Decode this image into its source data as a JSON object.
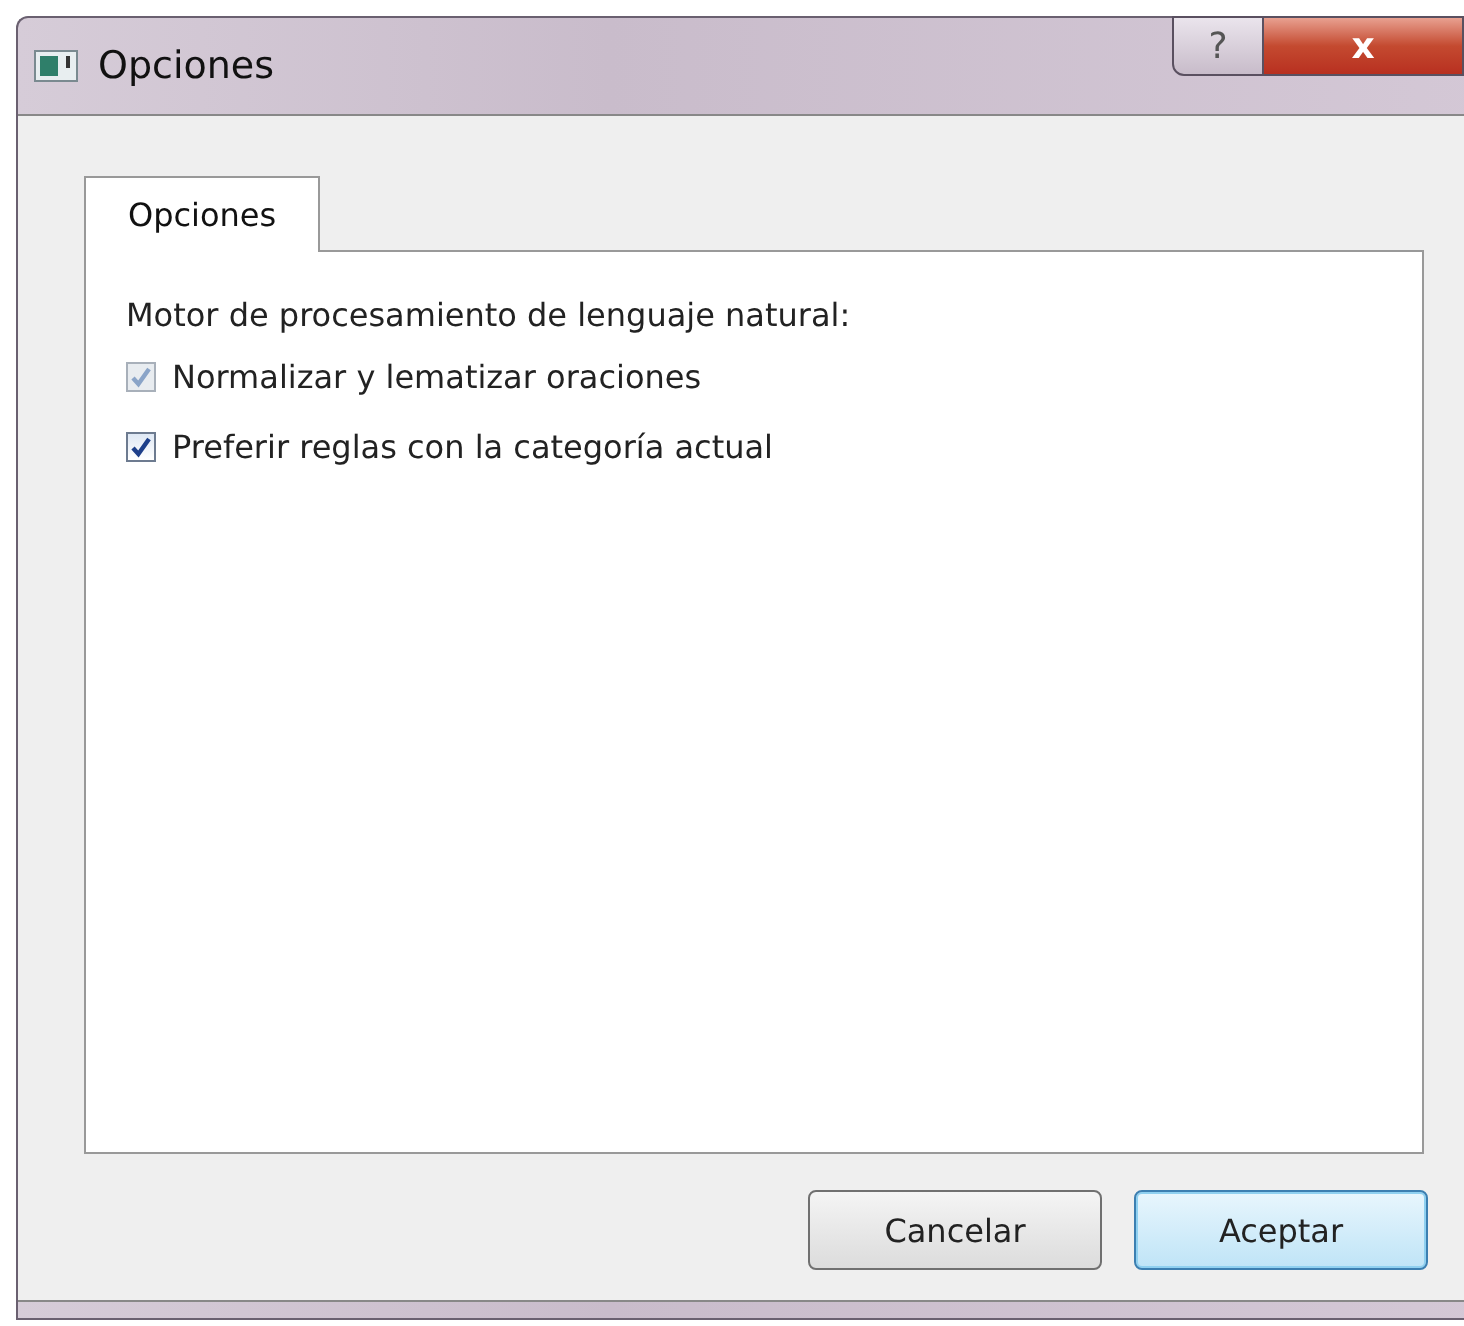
{
  "window": {
    "title": "Opciones",
    "help_button": "?",
    "close_button": "x"
  },
  "tabs": [
    {
      "label": "Opciones",
      "selected": true
    }
  ],
  "section_label": "Motor de procesamiento de lenguaje natural:",
  "options": [
    {
      "label": "Normalizar y lematizar oraciones",
      "checked": true,
      "disabled": true
    },
    {
      "label": "Preferir reglas con la categoría actual",
      "checked": true,
      "disabled": false
    }
  ],
  "buttons": [
    {
      "label": "Cancelar",
      "default": false
    },
    {
      "label": "Aceptar",
      "default": true
    }
  ]
}
